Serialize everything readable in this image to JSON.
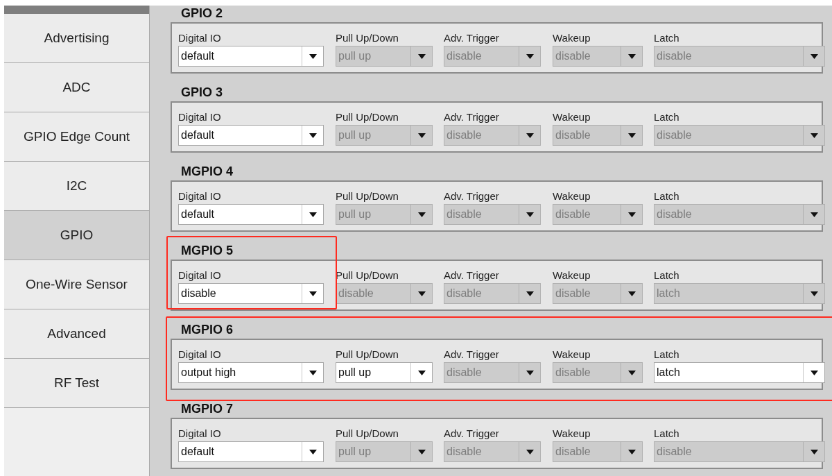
{
  "sidebar": {
    "items": [
      {
        "label": "Advertising",
        "selected": false
      },
      {
        "label": "ADC",
        "selected": false
      },
      {
        "label": "GPIO Edge Count",
        "selected": false
      },
      {
        "label": "I2C",
        "selected": false
      },
      {
        "label": "GPIO",
        "selected": true
      },
      {
        "label": "One-Wire Sensor",
        "selected": false
      },
      {
        "label": "Advanced",
        "selected": false
      },
      {
        "label": "RF Test",
        "selected": false
      }
    ]
  },
  "groups": [
    {
      "title": "GPIO 2",
      "highlighted": false,
      "fields": [
        {
          "label": "Digital IO",
          "value": "default",
          "disabled": false
        },
        {
          "label": "Pull Up/Down",
          "value": "pull up",
          "disabled": true
        },
        {
          "label": "Adv. Trigger",
          "value": "disable",
          "disabled": true
        },
        {
          "label": "Wakeup",
          "value": "disable",
          "disabled": true
        },
        {
          "label": "Latch",
          "value": "disable",
          "disabled": true
        }
      ]
    },
    {
      "title": "GPIO 3",
      "highlighted": false,
      "fields": [
        {
          "label": "Digital IO",
          "value": "default",
          "disabled": false
        },
        {
          "label": "Pull Up/Down",
          "value": "pull up",
          "disabled": true
        },
        {
          "label": "Adv. Trigger",
          "value": "disable",
          "disabled": true
        },
        {
          "label": "Wakeup",
          "value": "disable",
          "disabled": true
        },
        {
          "label": "Latch",
          "value": "disable",
          "disabled": true
        }
      ]
    },
    {
      "title": "MGPIO 4",
      "highlighted": false,
      "fields": [
        {
          "label": "Digital IO",
          "value": "default",
          "disabled": false
        },
        {
          "label": "Pull Up/Down",
          "value": "pull up",
          "disabled": true
        },
        {
          "label": "Adv. Trigger",
          "value": "disable",
          "disabled": true
        },
        {
          "label": "Wakeup",
          "value": "disable",
          "disabled": true
        },
        {
          "label": "Latch",
          "value": "disable",
          "disabled": true
        }
      ]
    },
    {
      "title": "MGPIO 5",
      "highlighted": true,
      "highlight_first_field_only": true,
      "fields": [
        {
          "label": "Digital IO",
          "value": "disable",
          "disabled": false
        },
        {
          "label": "Pull Up/Down",
          "value": "disable",
          "disabled": true
        },
        {
          "label": "Adv. Trigger",
          "value": "disable",
          "disabled": true
        },
        {
          "label": "Wakeup",
          "value": "disable",
          "disabled": true
        },
        {
          "label": "Latch",
          "value": "latch",
          "disabled": true
        }
      ]
    },
    {
      "title": "MGPIO 6",
      "highlighted": true,
      "highlight_first_field_only": false,
      "fields": [
        {
          "label": "Digital IO",
          "value": "output high",
          "disabled": false
        },
        {
          "label": "Pull Up/Down",
          "value": "pull up",
          "disabled": false
        },
        {
          "label": "Adv. Trigger",
          "value": "disable",
          "disabled": true
        },
        {
          "label": "Wakeup",
          "value": "disable",
          "disabled": true
        },
        {
          "label": "Latch",
          "value": "latch",
          "disabled": false
        }
      ]
    },
    {
      "title": "MGPIO 7",
      "highlighted": false,
      "fields": [
        {
          "label": "Digital IO",
          "value": "default",
          "disabled": false
        },
        {
          "label": "Pull Up/Down",
          "value": "pull up",
          "disabled": true
        },
        {
          "label": "Adv. Trigger",
          "value": "disable",
          "disabled": true
        },
        {
          "label": "Wakeup",
          "value": "disable",
          "disabled": true
        },
        {
          "label": "Latch",
          "value": "disable",
          "disabled": true
        }
      ]
    }
  ]
}
